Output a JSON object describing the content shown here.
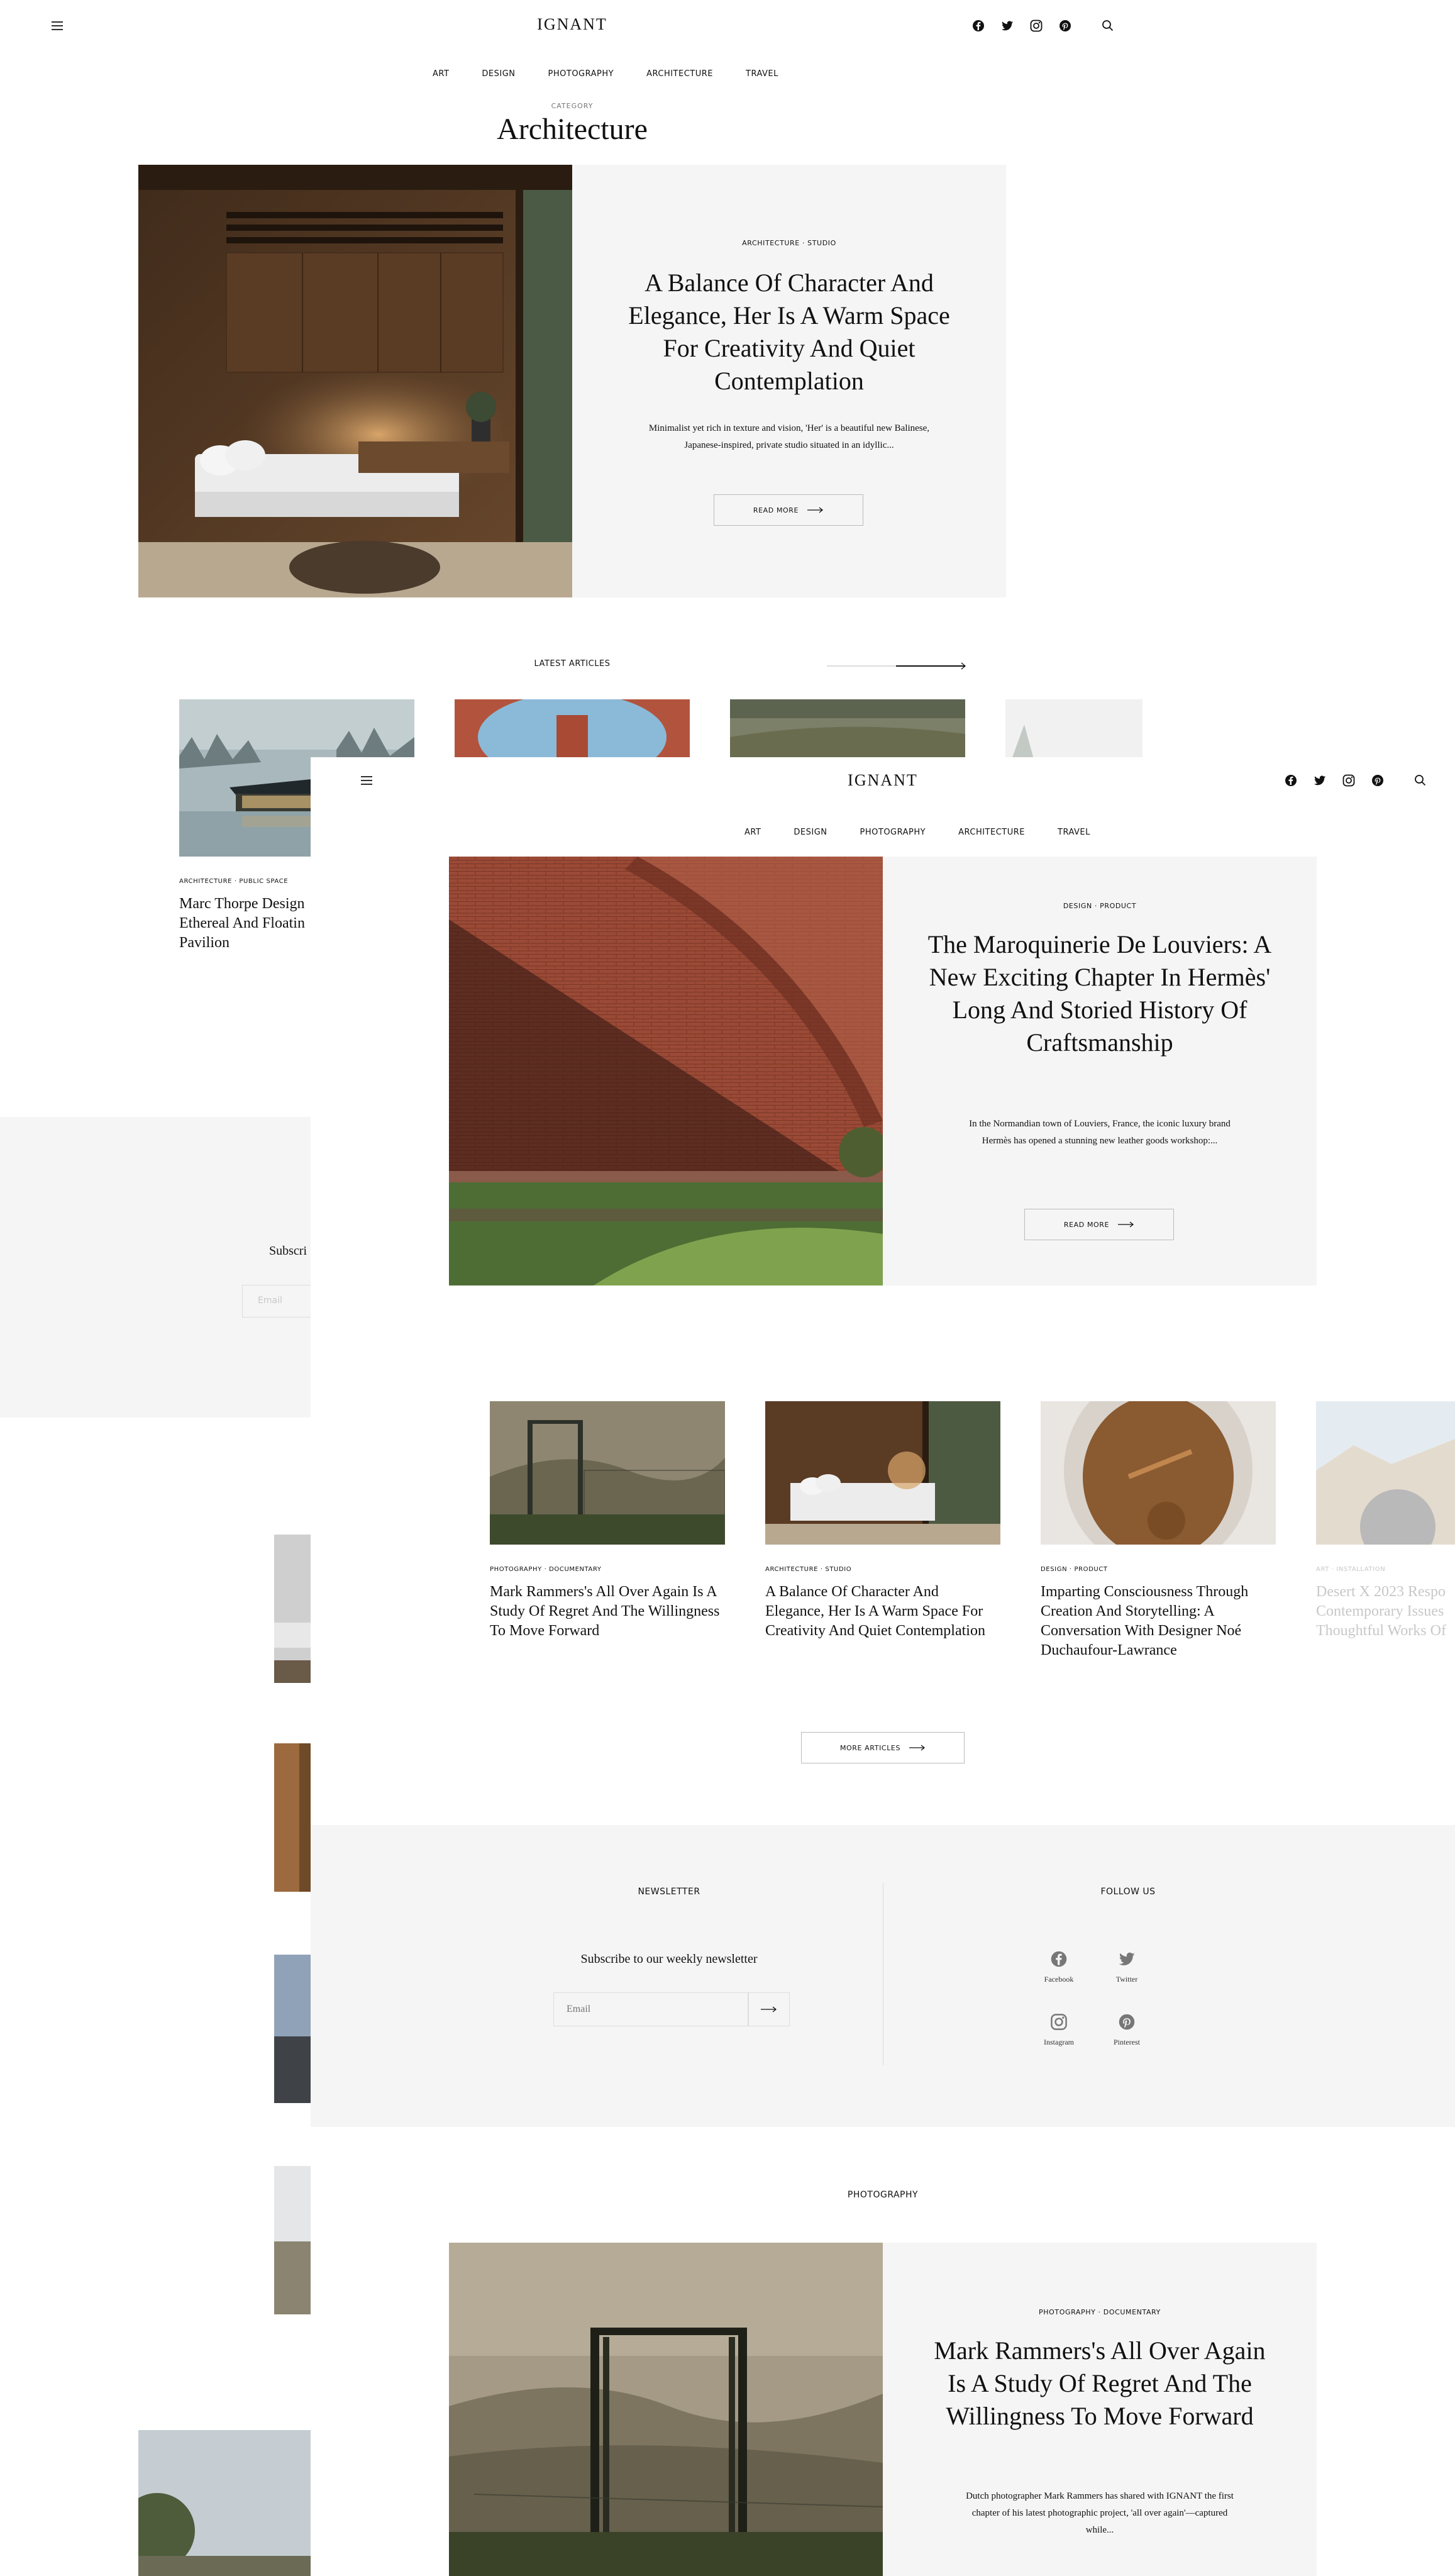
{
  "brand": {
    "logo": "IGNANT"
  },
  "nav": [
    "ART",
    "DESIGN",
    "PHOTOGRAPHY",
    "ARCHITECTURE",
    "TRAVEL"
  ],
  "page": {
    "category_label": "CATEGORY",
    "category_title": "Architecture"
  },
  "hero": {
    "tag": "ARCHITECTURE · STUDIO",
    "title": "A Balance Of Character And Elegance, Her Is A Warm Space For Creativity And Quiet Contemplation",
    "excerpt": "Minimalist yet rich in texture and vision, 'Her' is a beautiful new Balinese, Japanese-inspired, private studio situated in an idyllic...",
    "button": "READ MORE"
  },
  "latest": {
    "heading": "LATEST ARTICLES",
    "items": [
      {
        "tag": "ARCHITECTURE · PUBLIC SPACE",
        "title": "Marc Thorpe Design Ethereal And Floatin Pavilion"
      }
    ]
  },
  "bg_newsletter": {
    "text": "Subscri",
    "placeholder": "Email"
  },
  "overlay": {
    "feature": {
      "tag": "DESIGN · PRODUCT",
      "title": "The Maroquinerie De Louviers: A New Exciting Chapter In Hermès' Long And Storied History Of Craftsmanship",
      "excerpt": "In the Normandian town of Louviers, France, the iconic luxury brand Hermès has opened a stunning new leather goods workshop:...",
      "button": "READ MORE"
    },
    "cards": [
      {
        "tag": "PHOTOGRAPHY · DOCUMENTARY",
        "title": "Mark Rammers's All Over Again Is A Study Of Regret And The Willingness To Move Forward"
      },
      {
        "tag": "ARCHITECTURE · STUDIO",
        "title": "A Balance Of Character And Elegance, Her Is A Warm Space For Creativity And Quiet Contemplation"
      },
      {
        "tag": "DESIGN · PRODUCT",
        "title": "Imparting Consciousness Through Creation And Storytelling: A Conversation With Designer Noé Duchaufour-Lawrance"
      },
      {
        "tag": "ART · INSTALLATION",
        "title": "Desert X 2023 Respo Contemporary Issues Thoughtful Works Of"
      }
    ],
    "more_button": "MORE ARTICLES",
    "newsletter": {
      "heading": "NEWSLETTER",
      "subtitle": "Subscribe to our weekly newsletter",
      "placeholder": "Email"
    },
    "follow": {
      "heading": "FOLLOW US",
      "items": [
        {
          "label": "Facebook",
          "icon": "facebook-icon"
        },
        {
          "label": "Twitter",
          "icon": "twitter-icon"
        },
        {
          "label": "Instagram",
          "icon": "instagram-icon"
        },
        {
          "label": "Pinterest",
          "icon": "pinterest-icon"
        }
      ]
    },
    "section2": {
      "heading": "PHOTOGRAPHY",
      "tag": "PHOTOGRAPHY · DOCUMENTARY",
      "title": "Mark Rammers's All Over Again Is A Study Of Regret And The Willingness To Move Forward",
      "excerpt": "Dutch photographer Mark Rammers has shared with IGNANT the first chapter of his latest photographic project, 'all over again'—captured while..."
    }
  },
  "colors": {
    "panel_gray": "#f5f5f5",
    "text": "#111111",
    "muted": "#c8c8c8",
    "border": "#bbbbbb"
  }
}
